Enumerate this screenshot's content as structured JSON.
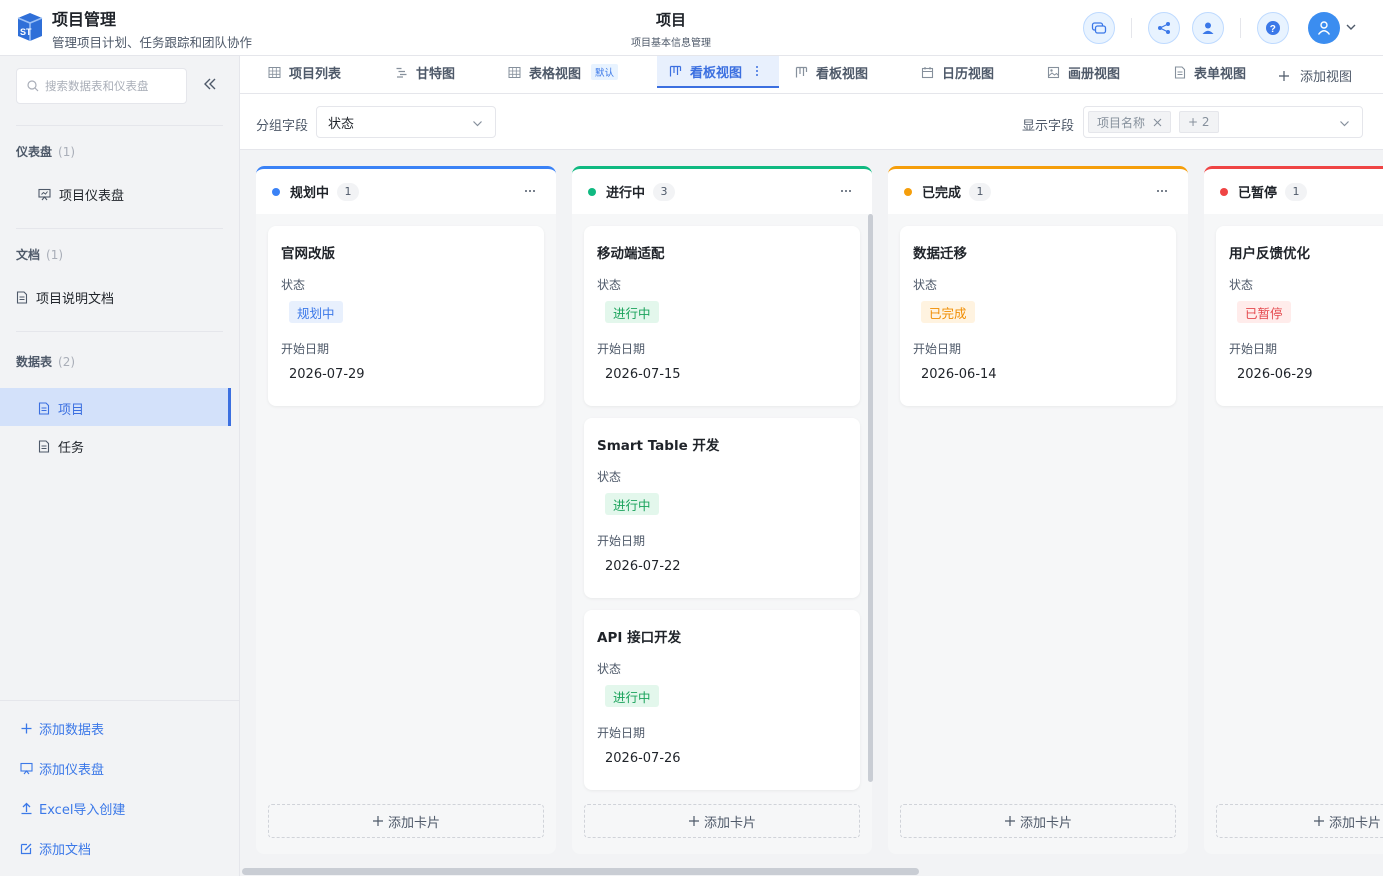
{
  "header": {
    "logo_text": "ST",
    "app_title": "项目管理",
    "app_subtitle": "管理项目计划、任务跟踪和团队协作",
    "page_title": "项目",
    "page_subtitle": "项目基本信息管理"
  },
  "sidebar": {
    "search_placeholder": "搜索数据表和仪表盘",
    "sections": [
      {
        "label": "仪表盘",
        "count": "(1)",
        "items": [
          "项目仪表盘"
        ]
      },
      {
        "label": "文档",
        "count": "(1)",
        "items": [
          "项目说明文档"
        ]
      },
      {
        "label": "数据表",
        "count": "(2)",
        "items": [
          "项目",
          "任务"
        ]
      }
    ],
    "selected": "项目",
    "actions": [
      "添加数据表",
      "添加仪表盘",
      "Excel导入创建",
      "添加文档"
    ]
  },
  "tabs": [
    {
      "label": "项目列表",
      "icon": "table-icon"
    },
    {
      "label": "甘特图",
      "icon": "gantt-icon"
    },
    {
      "label": "表格视图",
      "icon": "table-icon",
      "badge": "默认"
    },
    {
      "label": "看板视图",
      "icon": "kanban-icon",
      "active": true
    },
    {
      "label": "看板视图",
      "icon": "kanban-icon"
    },
    {
      "label": "日历视图",
      "icon": "calendar-icon"
    },
    {
      "label": "画册视图",
      "icon": "gallery-icon"
    },
    {
      "label": "表单视图",
      "icon": "form-icon"
    }
  ],
  "add_view": "添加视图",
  "toolbar": {
    "group_label": "分组字段",
    "group_value": "状态",
    "display_label": "显示字段",
    "display_tag": "项目名称",
    "display_more": "+ 2"
  },
  "field_labels": {
    "status": "状态",
    "start_date": "开始日期"
  },
  "add_card": "添加卡片",
  "columns": [
    {
      "name": "规划中",
      "count": "1",
      "color": "#3b82f6",
      "tag_bg": "#e8f0fd",
      "tag_fg": "#3b78e8",
      "cards": [
        {
          "title": "官网改版",
          "status": "规划中",
          "date": "2026-07-29"
        }
      ]
    },
    {
      "name": "进行中",
      "count": "3",
      "color": "#10b981",
      "tag_bg": "#e3f7ec",
      "tag_fg": "#1aa35b",
      "cards": [
        {
          "title": "移动端适配",
          "status": "进行中",
          "date": "2026-07-15"
        },
        {
          "title": "Smart Table 开发",
          "status": "进行中",
          "date": "2026-07-22"
        },
        {
          "title": "API 接口开发",
          "status": "进行中",
          "date": "2026-07-26"
        }
      ]
    },
    {
      "name": "已完成",
      "count": "1",
      "color": "#f59e0b",
      "tag_bg": "#fff3e0",
      "tag_fg": "#f08c00",
      "cards": [
        {
          "title": "数据迁移",
          "status": "已完成",
          "date": "2026-06-14"
        }
      ]
    },
    {
      "name": "已暂停",
      "count": "1",
      "color": "#ef4444",
      "tag_bg": "#ffeceb",
      "tag_fg": "#e5484d",
      "cards": [
        {
          "title": "用户反馈优化",
          "status": "已暂停",
          "date": "2026-06-29"
        }
      ]
    }
  ]
}
